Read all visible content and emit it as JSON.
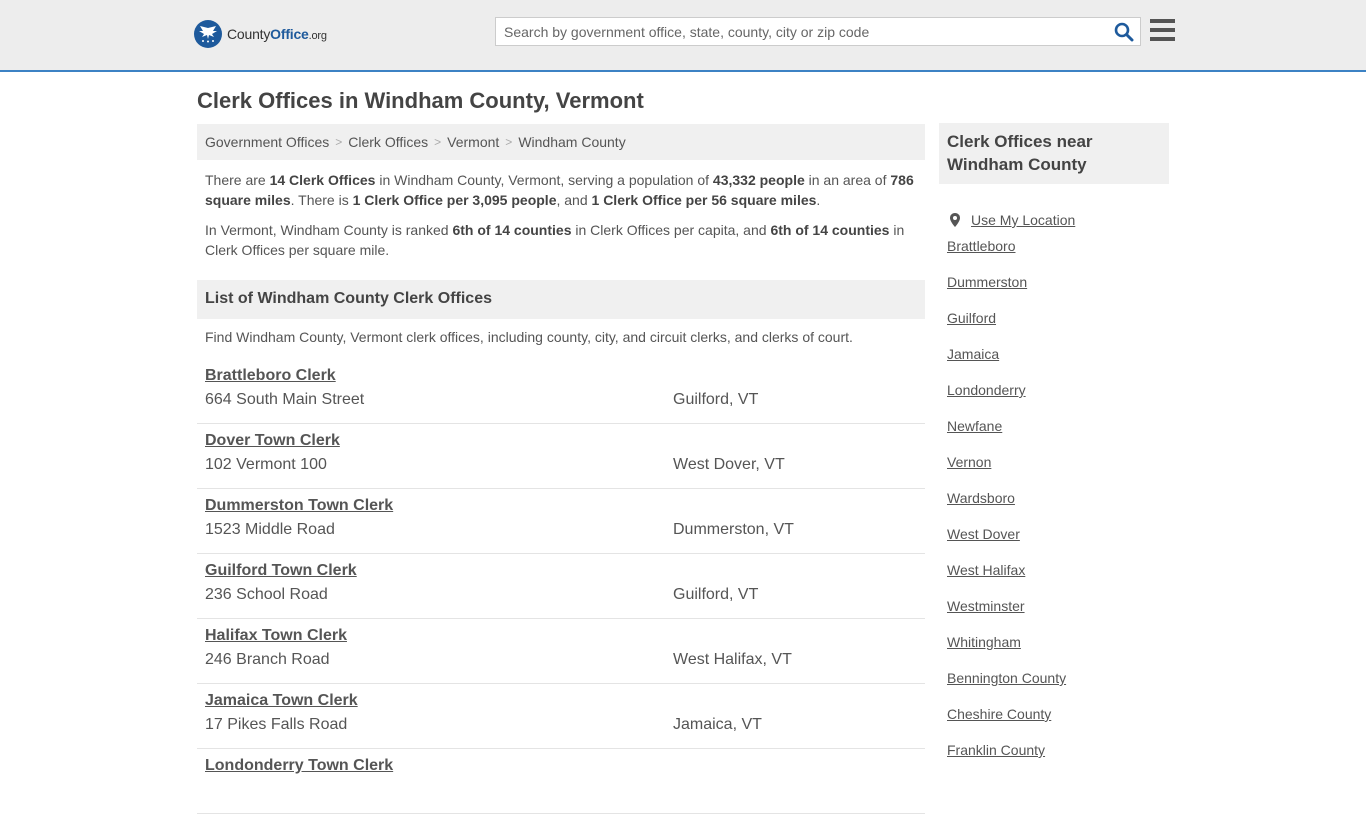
{
  "header": {
    "logo_prefix": "County",
    "logo_bold": "Office",
    "logo_suffix": ".org",
    "search_placeholder": "Search by government office, state, county, city or zip code"
  },
  "page_title": "Clerk Offices in Windham County, Vermont",
  "breadcrumb": [
    "Government Offices",
    "Clerk Offices",
    "Vermont",
    "Windham County"
  ],
  "intro": {
    "p1": {
      "t1": "There are ",
      "b1": "14 Clerk Offices",
      "t2": " in Windham County, Vermont, serving a population of ",
      "b2": "43,332 people",
      "t3": " in an area of ",
      "b3": "786 square miles",
      "t4": ". There is ",
      "b4": "1 Clerk Office per 3,095 people",
      "t5": ", and ",
      "b5": "1 Clerk Office per 56 square miles",
      "t6": "."
    },
    "p2": {
      "t1": "In Vermont, Windham County is ranked ",
      "b1": "6th of 14 counties",
      "t2": " in Clerk Offices per capita, and ",
      "b2": "6th of 14 counties",
      "t3": " in Clerk Offices per square mile."
    }
  },
  "list": {
    "header": "List of Windham County Clerk Offices",
    "description": "Find Windham County, Vermont clerk offices, including county, city, and circuit clerks, and clerks of court.",
    "offices": [
      {
        "name": "Brattleboro Clerk",
        "address": "664 South Main Street",
        "city": "Guilford, VT"
      },
      {
        "name": "Dover Town Clerk",
        "address": "102 Vermont 100",
        "city": "West Dover, VT"
      },
      {
        "name": "Dummerston Town Clerk",
        "address": "1523 Middle Road",
        "city": "Dummerston, VT"
      },
      {
        "name": "Guilford Town Clerk",
        "address": "236 School Road",
        "city": "Guilford, VT"
      },
      {
        "name": "Halifax Town Clerk",
        "address": "246 Branch Road",
        "city": "West Halifax, VT"
      },
      {
        "name": "Jamaica Town Clerk",
        "address": "17 Pikes Falls Road",
        "city": "Jamaica, VT"
      },
      {
        "name": "Londonderry Town Clerk",
        "address": "",
        "city": ""
      }
    ]
  },
  "sidebar": {
    "title": "Clerk Offices near Windham County",
    "use_location": "Use My Location",
    "links": [
      "Brattleboro",
      "Dummerston",
      "Guilford",
      "Jamaica",
      "Londonderry",
      "Newfane",
      "Vernon",
      "Wardsboro",
      "West Dover",
      "West Halifax",
      "Westminster",
      "Whitingham",
      "Bennington County",
      "Cheshire County",
      "Franklin County"
    ]
  },
  "colors": {
    "accent": "#1e5a9c",
    "topbar_border": "#3c82c4"
  }
}
